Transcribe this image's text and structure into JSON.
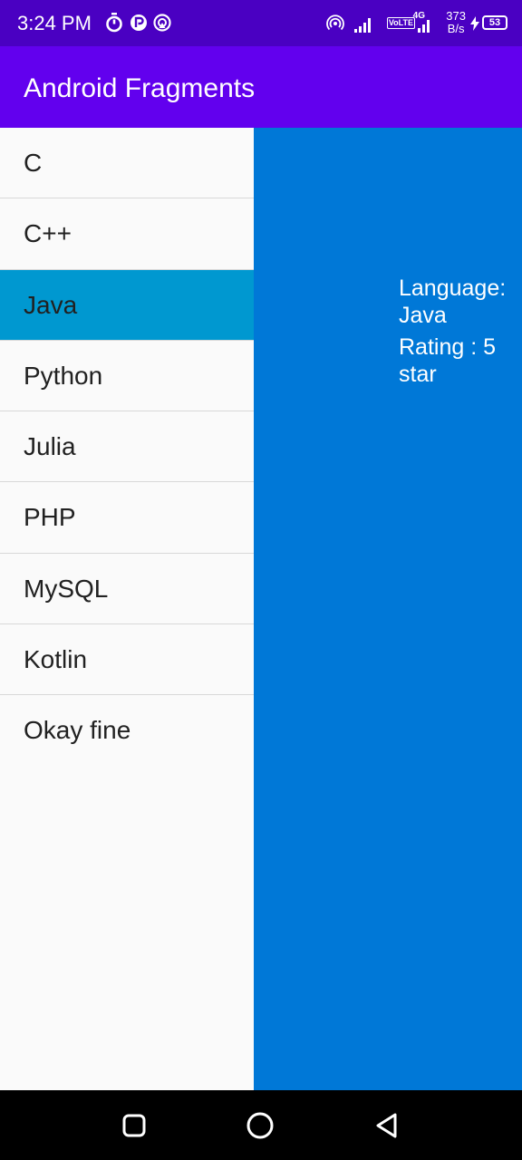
{
  "status_bar": {
    "time": "3:24 PM",
    "network": "4G",
    "volte": "VoLTE",
    "speed_value": "373",
    "speed_unit": "B/s",
    "battery": "53",
    "icons": [
      "timer-icon",
      "paytm-icon",
      "cast-icon",
      "hotspot-icon",
      "signal-icon",
      "signal-4g-icon",
      "charging-icon",
      "battery-icon"
    ]
  },
  "app_bar": {
    "title": "Android Fragments",
    "color": "#6200ee"
  },
  "list": {
    "selected_index": 2,
    "selected_color": "#0098d0",
    "items": [
      {
        "label": "C"
      },
      {
        "label": "C++"
      },
      {
        "label": "Java"
      },
      {
        "label": "Python"
      },
      {
        "label": "Julia"
      },
      {
        "label": "PHP"
      },
      {
        "label": "MySQL"
      },
      {
        "label": "Kotlin"
      },
      {
        "label": "Okay fine"
      }
    ]
  },
  "detail": {
    "background": "#0078d7",
    "language": "Language: Java",
    "rating": "Rating : 5 star"
  },
  "nav_bar": {
    "icons": [
      "recents-icon",
      "home-icon",
      "back-icon"
    ]
  }
}
